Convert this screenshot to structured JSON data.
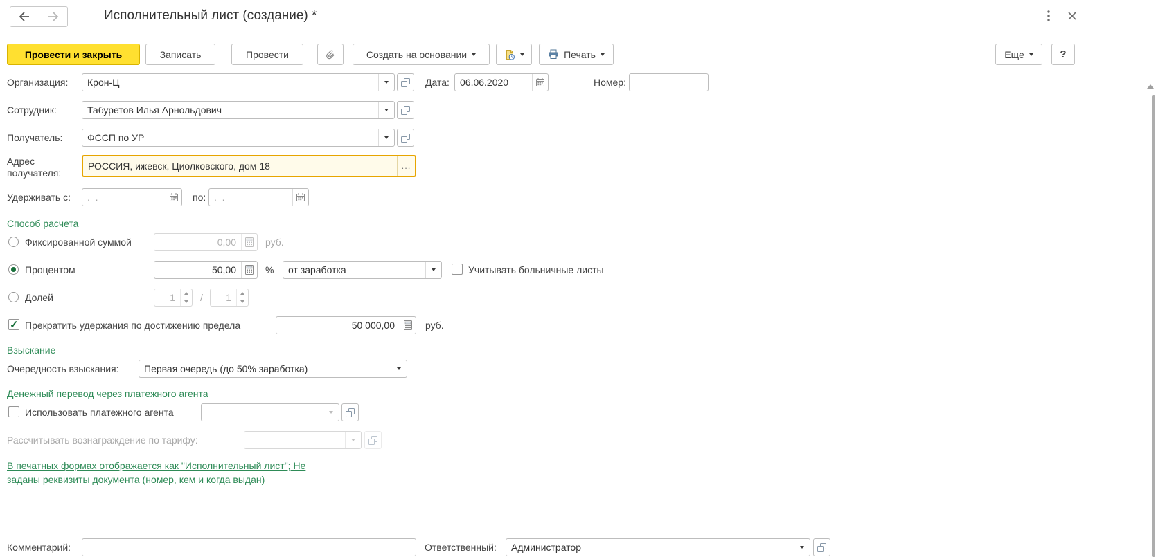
{
  "window": {
    "title": "Исполнительный лист (создание) *"
  },
  "toolbar": {
    "post_and_close": "Провести и закрыть",
    "save": "Записать",
    "post": "Провести",
    "create_based_on": "Создать на основании",
    "print": "Печать",
    "more": "Еще",
    "help": "?"
  },
  "form": {
    "organization": {
      "label": "Организация:",
      "value": "Крон-Ц"
    },
    "date": {
      "label": "Дата:",
      "value": "06.06.2020"
    },
    "number": {
      "label": "Номер:",
      "value": ""
    },
    "employee": {
      "label": "Сотрудник:",
      "value": "Табуретов Илья Арнольдович"
    },
    "recipient": {
      "label": "Получатель:",
      "value": "ФССП по УР"
    },
    "recipient_address": {
      "label": "Адрес получателя:",
      "value": "РОССИЯ, ижевск, Циолковского, дом 18",
      "more": "..."
    },
    "withhold": {
      "from_label": "Удерживать с:",
      "from_value": ".  .",
      "to_label": "по:",
      "to_value": ".  ."
    }
  },
  "calc_method": {
    "header": "Способ расчета",
    "fixed": {
      "label": "Фиксированной суммой",
      "value": "0,00",
      "unit": "руб.",
      "selected": false
    },
    "percent": {
      "label": "Процентом",
      "value": "50,00",
      "unit": "%",
      "source": "от заработка",
      "selected": true
    },
    "sick_leave": {
      "label": "Учитывать больничные листы",
      "checked": false
    },
    "share": {
      "label": "Долей",
      "numerator": "1",
      "slash": "/",
      "denominator": "1",
      "selected": false
    },
    "limit": {
      "label": "Прекратить удержания по достижению предела",
      "value": "50 000,00",
      "unit": "руб.",
      "checked": true
    }
  },
  "collection": {
    "header": "Взыскание",
    "priority_label": "Очередность взыскания:",
    "priority_value": "Первая очередь (до 50% заработка)"
  },
  "payment_agent": {
    "header": "Денежный перевод через платежного агента",
    "use_label": "Использовать платежного агента",
    "use_checked": false,
    "use_value": "",
    "tariff_label": "Рассчитывать вознаграждение по тарифу:",
    "tariff_value": ""
  },
  "footer": {
    "warning": "В печатных формах отображается как \"Исполнительный лист\"; Не заданы реквизиты документа (номер, кем и когда выдан)",
    "comment_label": "Комментарий:",
    "comment_value": "",
    "responsible_label": "Ответственный:",
    "responsible_value": "Администратор"
  },
  "colors": {
    "accent_green": "#2e8b57",
    "primary_button": "#ffe030",
    "focus_border": "#e7a500"
  }
}
